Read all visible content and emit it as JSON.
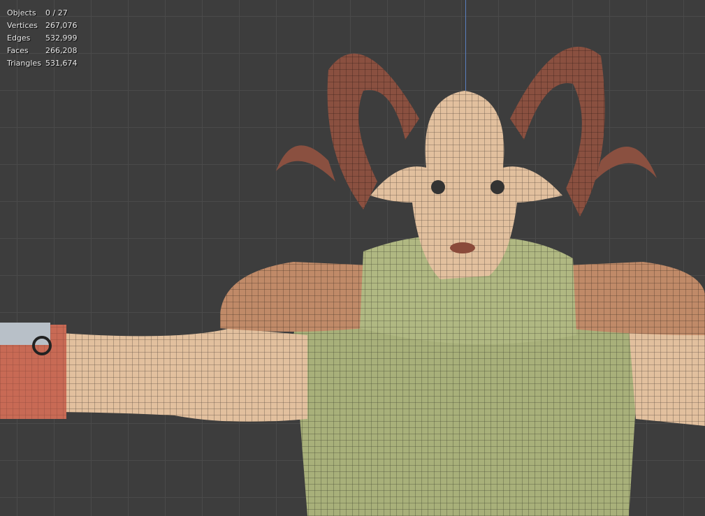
{
  "stats": [
    {
      "label": "Objects",
      "value": "0 / 27"
    },
    {
      "label": "Vertices",
      "value": "267,076"
    },
    {
      "label": "Edges",
      "value": "532,999"
    },
    {
      "label": "Faces",
      "value": "266,208"
    },
    {
      "label": "Triangles",
      "value": "531,674"
    }
  ],
  "colors": {
    "background": "#3d3d3d",
    "grid": "#4a4a4a",
    "axis": "#5a80c0",
    "horn": "#8a5040",
    "skin": "#e2c09e",
    "shirt": "#a8b07a",
    "shoulder": "#c08a68",
    "bracer": "#c86a55"
  }
}
